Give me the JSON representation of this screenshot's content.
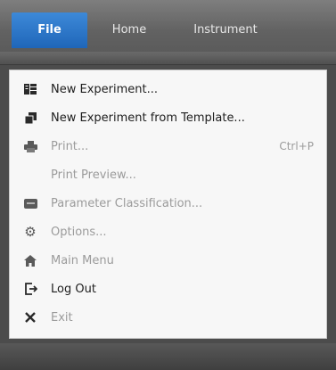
{
  "ribbon": {
    "tabs": [
      {
        "label": "File",
        "active": true
      },
      {
        "label": "Home",
        "active": false
      },
      {
        "label": "Instrument",
        "active": false
      }
    ]
  },
  "file_menu": {
    "items": [
      {
        "label": "New Experiment...",
        "icon": "new-experiment-icon",
        "enabled": true
      },
      {
        "label": "New Experiment from Template...",
        "icon": "template-icon",
        "enabled": true
      },
      {
        "label": "Print...",
        "icon": "printer-icon",
        "enabled": false,
        "shortcut": "Ctrl+P"
      },
      {
        "label": "Print Preview...",
        "icon": "",
        "enabled": false
      },
      {
        "label": "Parameter Classification...",
        "icon": "parameter-classification-icon",
        "enabled": false
      },
      {
        "label": "Options...",
        "icon": "gear-icon",
        "enabled": false
      },
      {
        "label": "Main Menu",
        "icon": "home-icon",
        "enabled": false
      },
      {
        "label": "Log Out",
        "icon": "logout-icon",
        "enabled": true
      },
      {
        "label": "Exit",
        "icon": "close-icon",
        "enabled": false
      }
    ]
  },
  "colors": {
    "file_tab": "#2a74c9",
    "menu_bg": "#f7f7f7",
    "disabled_text": "#9b9b9b",
    "enabled_text": "#1e1e1e"
  }
}
